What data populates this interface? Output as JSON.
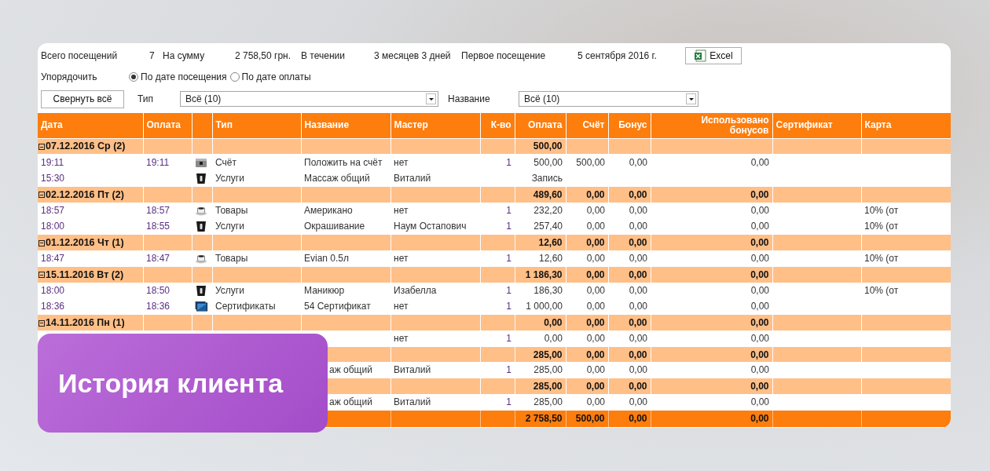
{
  "summary": [
    {
      "label": "Всего посещений",
      "value": "7"
    },
    {
      "label": "На сумму",
      "value": "2 758,50 грн."
    },
    {
      "label": "В течении",
      "value": "3 месяцев 3 дней"
    },
    {
      "label": "Первое посещение",
      "value": "5 сентября 2016 г."
    }
  ],
  "excel_button": {
    "label": "Excel"
  },
  "sort": {
    "label": "Упорядочить",
    "options": [
      {
        "label": "По дате посещения",
        "selected": true
      },
      {
        "label": "По дате оплаты",
        "selected": false
      }
    ]
  },
  "collapse_button": {
    "label": "Свернуть всё"
  },
  "filters": [
    {
      "label": "Тип",
      "value": "Всё (10)"
    },
    {
      "label": "Название",
      "value": "Всё (10)"
    }
  ],
  "table": {
    "columns": [
      "Дата",
      "Оплата",
      "Тип",
      "Название",
      "Мастер",
      "К-во",
      "Оплата",
      "Счёт",
      "Бонус",
      "Использовано бонусов",
      "Сертификат",
      "Карта"
    ],
    "rows": [
      {
        "kind": "group",
        "expanded": true,
        "title": "07.12.2016 Ср (2)",
        "payment": "500,00"
      },
      {
        "kind": "item",
        "date": "19:11",
        "paid_time": "19:11",
        "type": {
          "kind": "account",
          "label": "Счёт"
        },
        "name": "Положить на счёт",
        "master": "нет",
        "qty": "1",
        "payment": "500,00",
        "account": "500,00",
        "bonus": "0,00",
        "used_bonus": "0,00"
      },
      {
        "kind": "item",
        "date": "15:30",
        "type": {
          "kind": "service",
          "label": "Услуги"
        },
        "name": "Массаж общий",
        "master": "Виталий",
        "payment": "Запись"
      },
      {
        "kind": "group",
        "expanded": true,
        "title": "02.12.2016 Пт (2)",
        "payment": "489,60",
        "account": "0,00",
        "bonus": "0,00",
        "used_bonus": "0,00"
      },
      {
        "kind": "item",
        "date": "18:57",
        "paid_time": "18:57",
        "type": {
          "kind": "goods",
          "label": "Товары"
        },
        "name": "Американо",
        "master": "нет",
        "qty": "1",
        "payment": "232,20",
        "account": "0,00",
        "bonus": "0,00",
        "used_bonus": "0,00",
        "card": "10% (от"
      },
      {
        "kind": "item",
        "date": "18:00",
        "paid_time": "18:55",
        "type": {
          "kind": "service",
          "label": "Услуги"
        },
        "name": "Окрашивание",
        "master": "Наум Остапович",
        "qty": "1",
        "payment": "257,40",
        "account": "0,00",
        "bonus": "0,00",
        "used_bonus": "0,00",
        "card": "10% (от"
      },
      {
        "kind": "group",
        "expanded": true,
        "title": "01.12.2016 Чт (1)",
        "payment": "12,60",
        "account": "0,00",
        "bonus": "0,00",
        "used_bonus": "0,00"
      },
      {
        "kind": "item",
        "date": "18:47",
        "paid_time": "18:47",
        "type": {
          "kind": "goods",
          "label": "Товары"
        },
        "name": "Evian 0.5л",
        "master": "нет",
        "qty": "1",
        "payment": "12,60",
        "account": "0,00",
        "bonus": "0,00",
        "used_bonus": "0,00",
        "card": "10% (от"
      },
      {
        "kind": "group",
        "expanded": true,
        "title": "15.11.2016 Вт (2)",
        "payment": "1 186,30",
        "account": "0,00",
        "bonus": "0,00",
        "used_bonus": "0,00"
      },
      {
        "kind": "item",
        "date": "18:00",
        "paid_time": "18:50",
        "type": {
          "kind": "service",
          "label": "Услуги"
        },
        "name": "Маникюр",
        "master": "Изабелла",
        "qty": "1",
        "payment": "186,30",
        "account": "0,00",
        "bonus": "0,00",
        "used_bonus": "0,00",
        "card": "10% (от"
      },
      {
        "kind": "item",
        "date": "18:36",
        "paid_time": "18:36",
        "type": {
          "kind": "certificate",
          "label": "Сертификаты"
        },
        "name": "54 Сертификат",
        "master": "нет",
        "qty": "1",
        "payment": "1 000,00",
        "account": "0,00",
        "bonus": "0,00",
        "used_bonus": "0,00"
      },
      {
        "kind": "group",
        "expanded": true,
        "title": "14.11.2016 Пн (1)",
        "payment": "0,00",
        "account": "0,00",
        "bonus": "0,00",
        "used_bonus": "0,00"
      },
      {
        "kind": "item",
        "master": "нет",
        "qty": "1",
        "payment": "0,00",
        "account": "0,00",
        "bonus": "0,00",
        "used_bonus": "0,00"
      },
      {
        "kind": "group",
        "payment": "285,00",
        "account": "0,00",
        "bonus": "0,00",
        "used_bonus": "0,00"
      },
      {
        "kind": "item",
        "name": "аж общий",
        "clipped": true,
        "master": "Виталий",
        "qty": "1",
        "payment": "285,00",
        "account": "0,00",
        "bonus": "0,00",
        "used_bonus": "0,00"
      },
      {
        "kind": "group",
        "payment": "285,00",
        "account": "0,00",
        "bonus": "0,00",
        "used_bonus": "0,00"
      },
      {
        "kind": "item",
        "name": "аж общий",
        "clipped": true,
        "master": "Виталий",
        "qty": "1",
        "payment": "285,00",
        "account": "0,00",
        "bonus": "0,00",
        "used_bonus": "0,00"
      },
      {
        "kind": "total",
        "payment": "2 758,50",
        "account": "500,00",
        "bonus": "0,00",
        "used_bonus": "0,00"
      }
    ]
  },
  "banner": {
    "title": "История клиента"
  }
}
